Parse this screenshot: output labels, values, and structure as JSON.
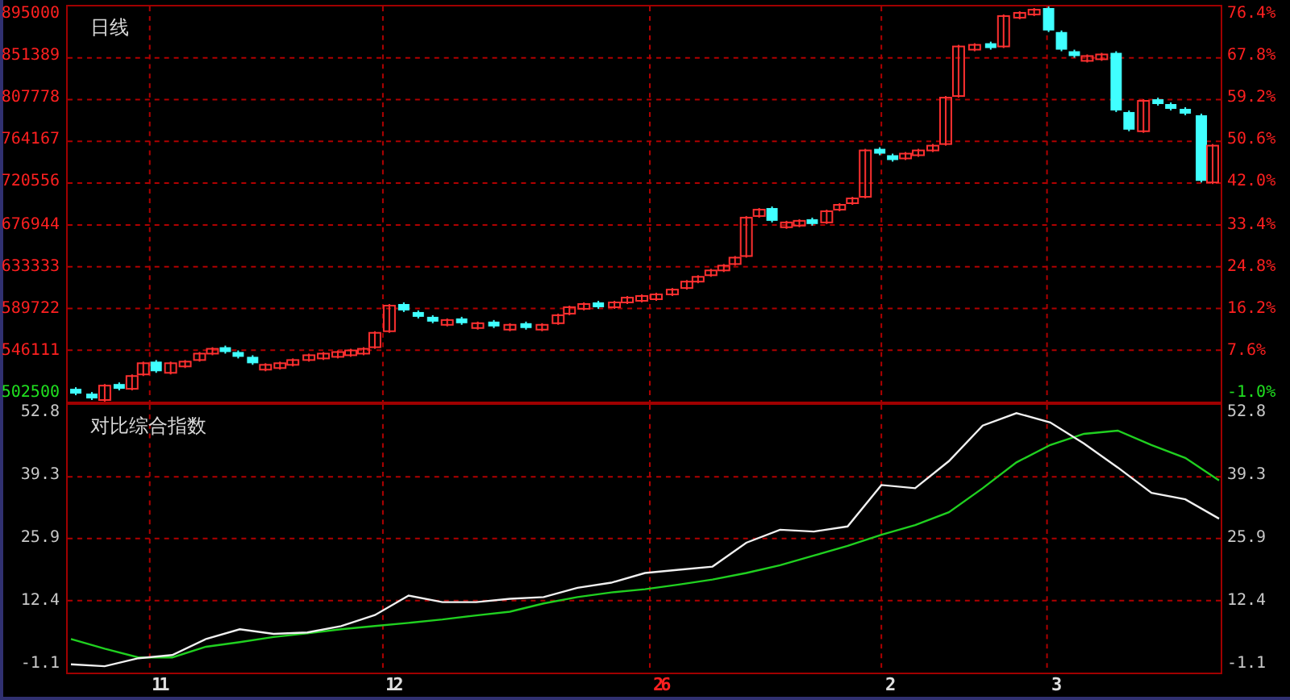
{
  "price_panel": {
    "title": "日线",
    "left_ticks": [
      {
        "label": "895000",
        "color": "#ff2020"
      },
      {
        "label": "851389",
        "color": "#ff2020"
      },
      {
        "label": "807778",
        "color": "#ff2020"
      },
      {
        "label": "764167",
        "color": "#ff2020"
      },
      {
        "label": "720556",
        "color": "#ff2020"
      },
      {
        "label": "676944",
        "color": "#ff2020"
      },
      {
        "label": "633333",
        "color": "#ff2020"
      },
      {
        "label": "589722",
        "color": "#ff2020"
      },
      {
        "label": "546111",
        "color": "#ff2020"
      },
      {
        "label": "502500",
        "color": "#20e020"
      }
    ],
    "right_ticks": [
      {
        "label": "76.4%",
        "color": "#ff2020"
      },
      {
        "label": "67.8%",
        "color": "#ff2020"
      },
      {
        "label": "59.2%",
        "color": "#ff2020"
      },
      {
        "label": "50.6%",
        "color": "#ff2020"
      },
      {
        "label": "42.0%",
        "color": "#ff2020"
      },
      {
        "label": "33.4%",
        "color": "#ff2020"
      },
      {
        "label": "24.8%",
        "color": "#ff2020"
      },
      {
        "label": "16.2%",
        "color": "#ff2020"
      },
      {
        "label": "7.6%",
        "color": "#ff2020"
      },
      {
        "label": "-1.0%",
        "color": "#20e020"
      }
    ]
  },
  "index_panel": {
    "title": "对比综合指数",
    "right_ticks": [
      {
        "label": "52.8"
      },
      {
        "label": "39.3"
      },
      {
        "label": "25.9"
      },
      {
        "label": "12.4"
      },
      {
        "label": "-1.1"
      }
    ],
    "chart_data": {
      "type": "line",
      "grid": true,
      "ylim": [
        -3.2,
        54.9
      ],
      "yticks": [
        52.8,
        39.3,
        25.9,
        12.4,
        -1.1
      ],
      "series": [
        {
          "color": "#f0f0f0",
          "values": [
            -1.4,
            -1.8,
            -0.1,
            0.6,
            4.1,
            6.2,
            5.2,
            5.5,
            6.9,
            9.3,
            13.5,
            12.1,
            12.1,
            12.8,
            13.2,
            15.2,
            16.3,
            18.4,
            19.1,
            19.8,
            25.0,
            27.8,
            27.4,
            28.5,
            37.5,
            36.8,
            42.7,
            50.4,
            53.1,
            51.1,
            46.5,
            41.3,
            35.8,
            34.4,
            30.2
          ]
        },
        {
          "color": "#20d020",
          "values": [
            4.1,
            2.0,
            0.1,
            0.1,
            2.4,
            3.4,
            4.5,
            5.3,
            6.2,
            6.9,
            7.6,
            8.3,
            9.2,
            10.0,
            11.8,
            13.2,
            14.2,
            14.9,
            15.9,
            17.0,
            18.4,
            20.1,
            22.2,
            24.3,
            26.7,
            28.8,
            31.6,
            36.8,
            42.4,
            46.2,
            48.6,
            49.3,
            46.2,
            43.4,
            38.5
          ]
        }
      ]
    }
  },
  "x_axis": [
    {
      "label": "11",
      "color": "#e0e0e0"
    },
    {
      "label": "12",
      "color": "#e0e0e0"
    },
    {
      "label": "26",
      "color": "#ff2020"
    },
    {
      "label": "2",
      "color": "#e0e0e0"
    },
    {
      "label": "3",
      "color": "#e0e0e0"
    }
  ]
}
